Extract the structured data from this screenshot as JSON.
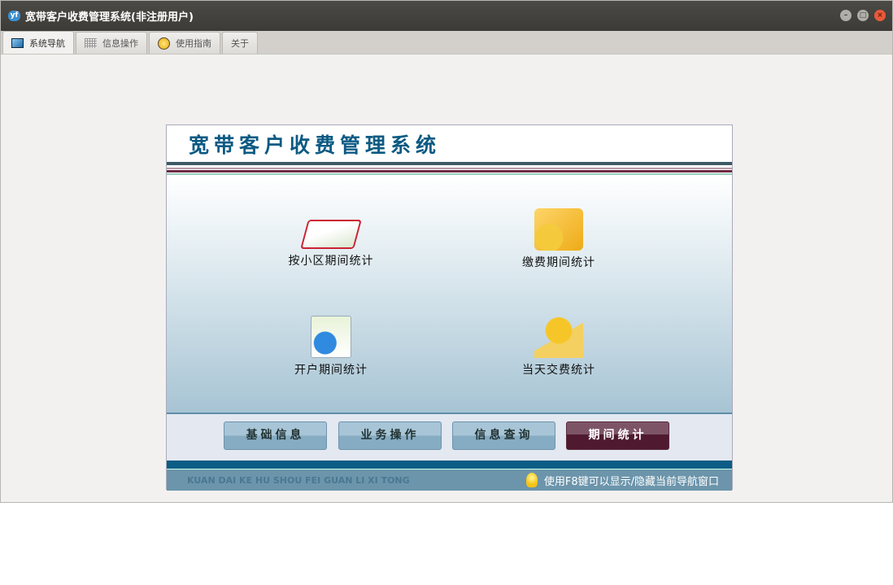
{
  "window": {
    "title": "宽带客户收费管理系统(非注册用户)",
    "logo": "yf",
    "controls": [
      "minimize",
      "maximize",
      "close"
    ]
  },
  "tabs": [
    {
      "label": "系统导航",
      "icon": "monitor-icon"
    },
    {
      "label": "信息操作",
      "icon": "grid-icon"
    },
    {
      "label": "使用指南",
      "icon": "help-icon"
    },
    {
      "label": "关于"
    }
  ],
  "panel": {
    "title": "宽带客户收费管理系统",
    "items": [
      {
        "label": "按小区期间统计",
        "icon": "book-icon"
      },
      {
        "label": "缴费期间统计",
        "icon": "coins-icon"
      },
      {
        "label": "开户期间统计",
        "icon": "globe-document-icon"
      },
      {
        "label": "当天交费统计",
        "icon": "coins-card-icon"
      }
    ],
    "nav_buttons": [
      "基础信息",
      "业务操作",
      "信息查询",
      "期间统计"
    ],
    "footer_pinyin": "KUAN DAI KE HU SHOU FEI GUAN LI XI TONG",
    "footer_tip": "使用F8键可以显示/隐藏当前导航窗口"
  },
  "colors": {
    "accent": "#0b5a83",
    "selected": "#4f1a30"
  }
}
